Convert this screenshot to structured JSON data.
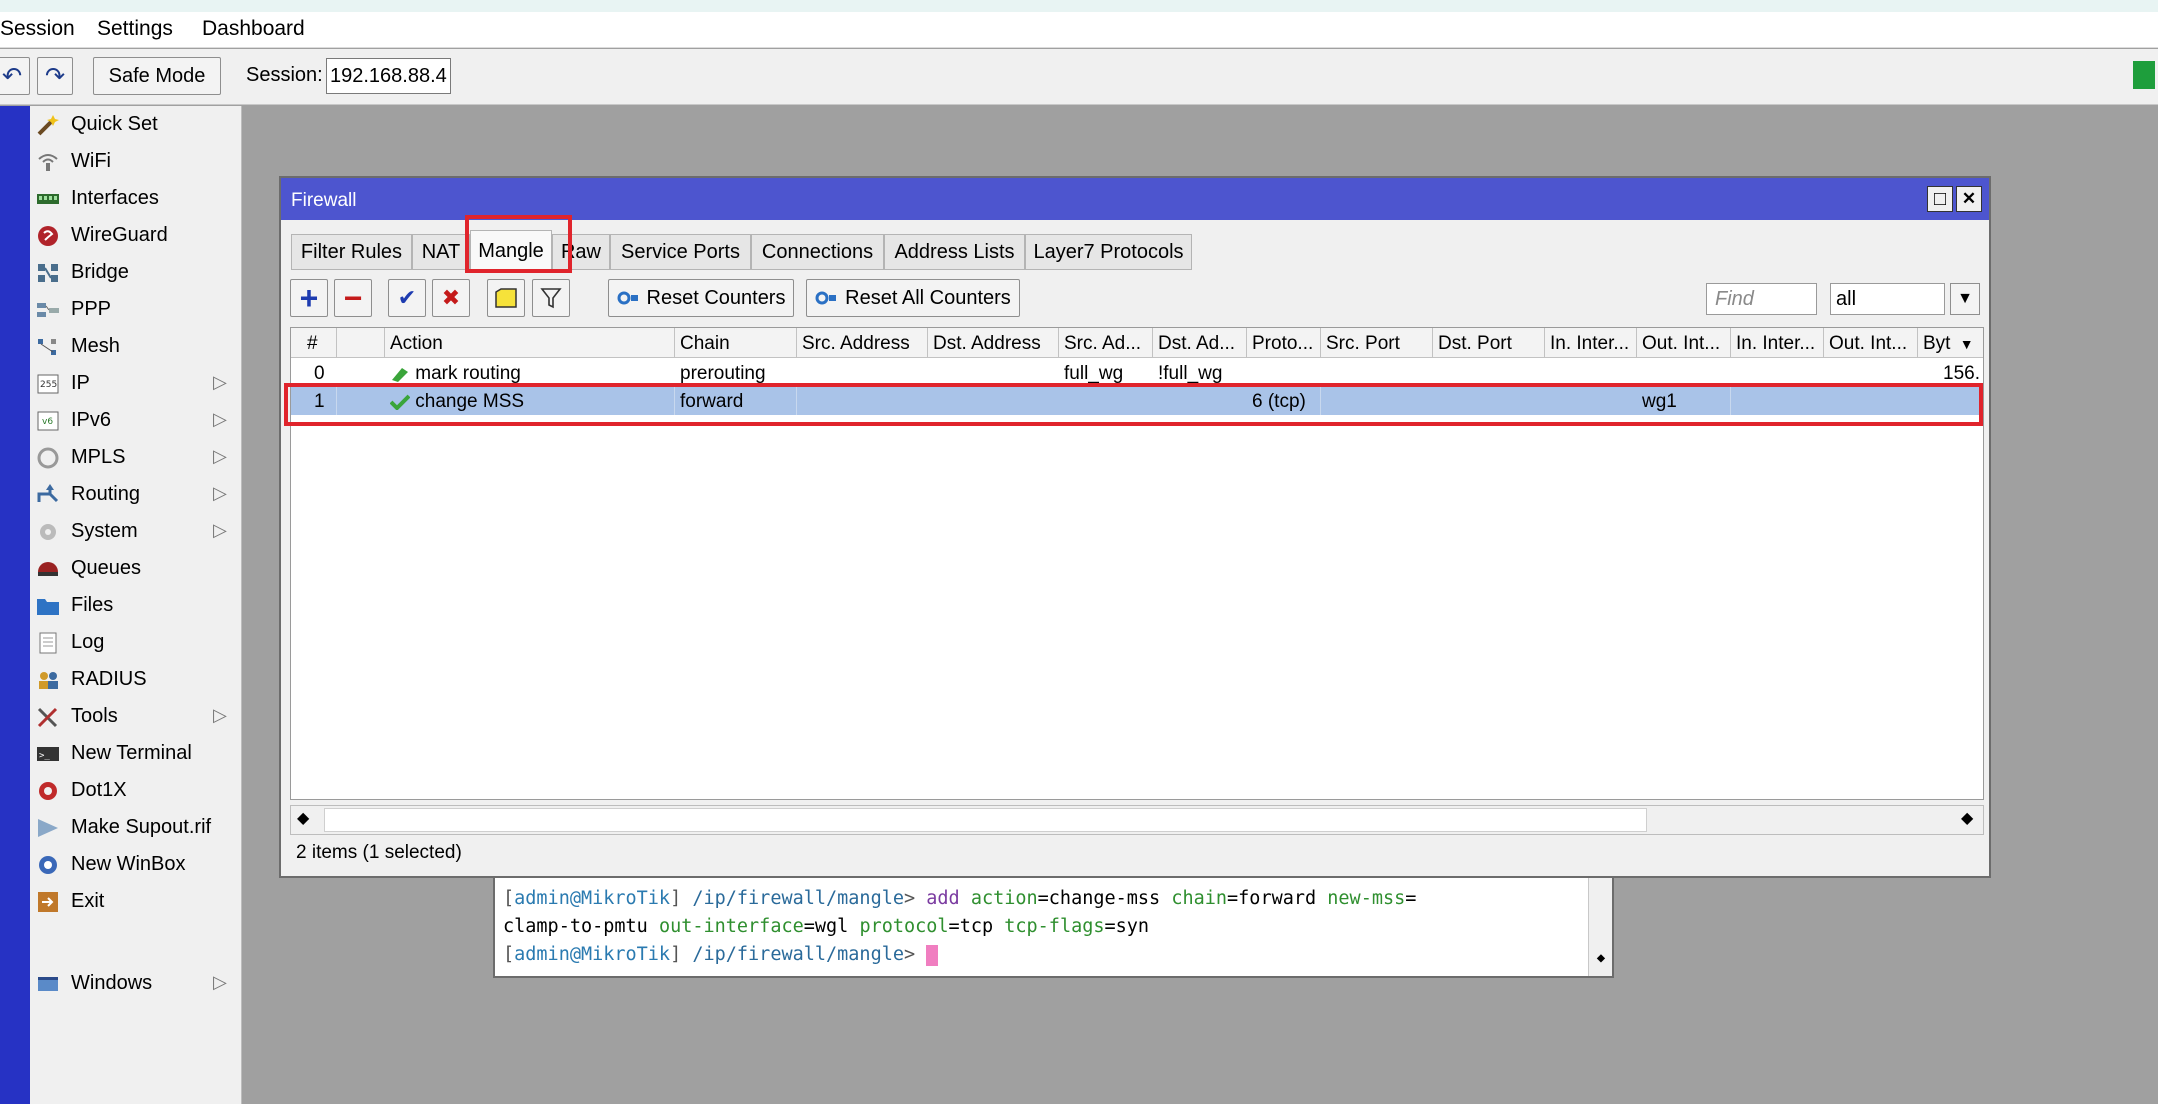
{
  "menu": {
    "session": "Session",
    "settings": "Settings",
    "dashboard": "Dashboard"
  },
  "toolbar": {
    "undo_icon": "↶",
    "redo_icon": "↷",
    "safe_mode": "Safe Mode",
    "session_label": "Session:",
    "session_value": "192.168.88.4"
  },
  "sidebar": {
    "items": [
      {
        "label": "Quick Set",
        "icon": "wand-icon",
        "arrow": ""
      },
      {
        "label": "WiFi",
        "icon": "wifi-icon",
        "arrow": ""
      },
      {
        "label": "Interfaces",
        "icon": "interfaces-icon",
        "arrow": ""
      },
      {
        "label": "WireGuard",
        "icon": "wireguard-icon",
        "arrow": ""
      },
      {
        "label": "Bridge",
        "icon": "bridge-icon",
        "arrow": ""
      },
      {
        "label": "PPP",
        "icon": "ppp-icon",
        "arrow": ""
      },
      {
        "label": "Mesh",
        "icon": "mesh-icon",
        "arrow": ""
      },
      {
        "label": "IP",
        "icon": "ip-icon",
        "arrow": "▷"
      },
      {
        "label": "IPv6",
        "icon": "ipv6-icon",
        "arrow": "▷"
      },
      {
        "label": "MPLS",
        "icon": "mpls-icon",
        "arrow": "▷"
      },
      {
        "label": "Routing",
        "icon": "routing-icon",
        "arrow": "▷"
      },
      {
        "label": "System",
        "icon": "system-gear-icon",
        "arrow": "▷"
      },
      {
        "label": "Queues",
        "icon": "queues-icon",
        "arrow": ""
      },
      {
        "label": "Files",
        "icon": "folder-icon",
        "arrow": ""
      },
      {
        "label": "Log",
        "icon": "log-icon",
        "arrow": ""
      },
      {
        "label": "RADIUS",
        "icon": "radius-icon",
        "arrow": ""
      },
      {
        "label": "Tools",
        "icon": "tools-icon",
        "arrow": "▷"
      },
      {
        "label": "New Terminal",
        "icon": "terminal-icon",
        "arrow": ""
      },
      {
        "label": "Dot1X",
        "icon": "dot1x-icon",
        "arrow": ""
      },
      {
        "label": "Make Supout.rif",
        "icon": "supout-icon",
        "arrow": ""
      },
      {
        "label": "New WinBox",
        "icon": "winbox-icon",
        "arrow": ""
      },
      {
        "label": "Exit",
        "icon": "exit-icon",
        "arrow": ""
      }
    ],
    "windows": {
      "label": "Windows",
      "icon": "windows-icon",
      "arrow": "▷"
    }
  },
  "firewall": {
    "title": "Firewall",
    "maximize_icon": "□",
    "close_icon": "✕",
    "tabs": [
      {
        "label": "Filter Rules"
      },
      {
        "label": "NAT"
      },
      {
        "label": "Mangle"
      },
      {
        "label": "Raw"
      },
      {
        "label": "Service Ports"
      },
      {
        "label": "Connections"
      },
      {
        "label": "Address Lists"
      },
      {
        "label": "Layer7 Protocols"
      }
    ],
    "active_tab": "Mangle",
    "buttons": {
      "add": "+",
      "remove": "−",
      "enable": "✔",
      "disable": "✖",
      "reset_counters": "Reset Counters",
      "reset_all_counters": "Reset All Counters"
    },
    "find_placeholder": "Find",
    "filter_value": "all",
    "filter_arrow": "▼",
    "columns": [
      "#",
      "",
      "Action",
      "Chain",
      "Src. Address",
      "Dst. Address",
      "Src. Ad...",
      "Dst. Ad...",
      "Proto...",
      "Src. Port",
      "Dst. Port",
      "In. Inter...",
      "Out. Int...",
      "In. Inter...",
      "Out. Int...",
      "Byt"
    ],
    "rows": [
      {
        "num": "0",
        "action": "mark routing",
        "chain": "prerouting",
        "src_list": "full_wg",
        "dst_list": "!full_wg",
        "proto": "",
        "out_iface": "",
        "bytes": "156."
      },
      {
        "num": "1",
        "action": "change MSS",
        "chain": "forward",
        "src_list": "",
        "dst_list": "",
        "proto": "6 (tcp)",
        "out_iface": "wg1",
        "bytes": ""
      }
    ],
    "selected_row": 1,
    "scroll_left": "◆",
    "scroll_right": "◆",
    "status": "2 items (1 selected)"
  },
  "terminal": {
    "line1": {
      "prompt_user": "admin@MikroTik",
      "prompt_path": "/ip/firewall/mangle",
      "cmd": "add",
      "k1": "action",
      "v1": "change-mss",
      "k2": "chain",
      "v2": "forward",
      "k3": "new-mss"
    },
    "line2": {
      "v3": "clamp-to-pmtu",
      "k4": "out-interface",
      "v4": "wgl",
      "k5": "protocol",
      "v5": "tcp",
      "k6": "tcp-flags",
      "v6": "syn"
    },
    "line3": {
      "prompt_user": "admin@MikroTik",
      "prompt_path": "/ip/firewall/mangle"
    },
    "scroll_down": "◆"
  },
  "colors": {
    "title_bar": "#4d55cf",
    "sidebar_strip": "#2632c4",
    "selected_row": "#a9c3e8",
    "highlight": "#e0242c",
    "session_indicator": "#1e9e3c"
  }
}
